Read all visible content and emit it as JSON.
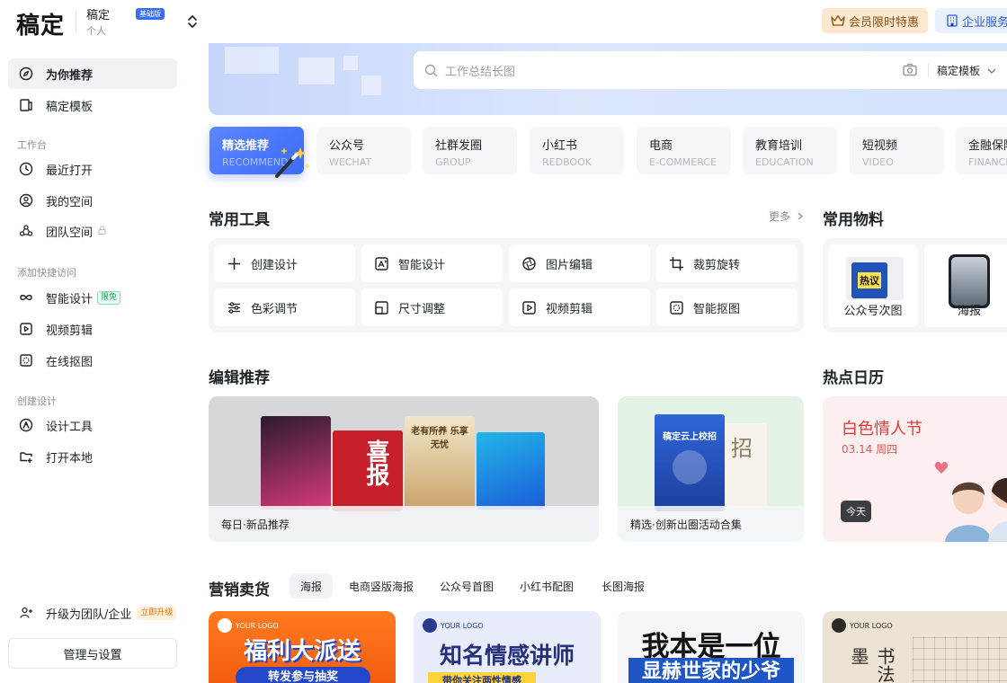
{
  "header": {
    "logo": "稿定",
    "workspace_name": "稿定",
    "workspace_type": "个人",
    "plan_badge": "基础版",
    "vip_label": "会员限时特惠",
    "enterprise_label": "企业服务"
  },
  "sidebar": {
    "top_items": [
      {
        "label": "为你推荐",
        "icon": "compass-icon"
      },
      {
        "label": "稿定模板",
        "icon": "template-icon"
      }
    ],
    "section_workspace": "工作台",
    "workspace_items": [
      {
        "label": "最近打开",
        "icon": "clock-icon"
      },
      {
        "label": "我的空间",
        "icon": "user-circle-icon"
      },
      {
        "label": "团队空间",
        "icon": "team-icon"
      }
    ],
    "section_quick": "添加快捷访问",
    "quick_items": [
      {
        "label": "智能设计",
        "tag": "限免",
        "icon": "infinity-icon"
      },
      {
        "label": "视频剪辑",
        "icon": "play-square-icon"
      },
      {
        "label": "在线抠图",
        "icon": "cutout-icon"
      }
    ],
    "section_create": "创建设计",
    "create_items": [
      {
        "label": "设计工具",
        "icon": "pen-nib-icon"
      },
      {
        "label": "打开本地",
        "icon": "folder-plus-icon"
      }
    ],
    "upgrade_label": "升级为团队/企业",
    "upgrade_tag": "立即升级",
    "settings_label": "管理与设置"
  },
  "search": {
    "placeholder": "工作总结长图",
    "scope": "稿定模板"
  },
  "categories": [
    {
      "cn": "精选推荐",
      "en": "RECOMMEND"
    },
    {
      "cn": "公众号",
      "en": "WECHAT"
    },
    {
      "cn": "社群发圈",
      "en": "GROUP"
    },
    {
      "cn": "小红书",
      "en": "REDBOOK"
    },
    {
      "cn": "电商",
      "en": "E-COMMERCE"
    },
    {
      "cn": "教育培训",
      "en": "EDUCATION"
    },
    {
      "cn": "短视频",
      "en": "VIDEO"
    },
    {
      "cn": "金融保险",
      "en": "FINANCIAL"
    }
  ],
  "tools": {
    "title": "常用工具",
    "more": "更多",
    "items": [
      {
        "label": "创建设计",
        "icon": "plus-icon"
      },
      {
        "label": "智能设计",
        "icon": "ai-design-icon"
      },
      {
        "label": "图片编辑",
        "icon": "aperture-icon"
      },
      {
        "label": "裁剪旋转",
        "icon": "crop-icon"
      },
      {
        "label": "色彩调节",
        "icon": "sliders-icon"
      },
      {
        "label": "尺寸调整",
        "icon": "resize-icon"
      },
      {
        "label": "视频剪辑",
        "icon": "play-square-icon"
      },
      {
        "label": "智能抠图",
        "icon": "cutout-icon"
      }
    ]
  },
  "materials": {
    "title": "常用物料",
    "items": [
      {
        "label": "公众号次图",
        "thumb_text": "热议"
      },
      {
        "label": "海报"
      }
    ]
  },
  "edit_recommend": {
    "title": "编辑推荐",
    "cards": [
      {
        "caption": "每日·新品推荐",
        "poster_texts": [
          "喜报",
          "老有所养 乐享无忧"
        ]
      },
      {
        "caption": "精选·创新出圈活动合集",
        "poster_texts": [
          "稿定云上校招",
          "招"
        ]
      }
    ]
  },
  "hot_calendar": {
    "title": "热点日历",
    "event": "白色情人节",
    "date": "03.14 周四",
    "today": "今天"
  },
  "marketing": {
    "title": "营销卖货",
    "tabs": [
      "海报",
      "电商竖版海报",
      "公众号首图",
      "小红书配图",
      "长图海报"
    ],
    "templates": [
      {
        "logo": "YOUR LOGO",
        "headline": "福利大派送",
        "sub": "转发参与抽奖"
      },
      {
        "logo": "YOUR LOGO",
        "headline": "知名情感讲师",
        "sub": "带你关注两性情感"
      },
      {
        "headline": "我本是一位",
        "sub": "显赫世家的少爷"
      },
      {
        "logo": "YOUR LOGO",
        "headline": "书法墨"
      }
    ]
  },
  "colors": {
    "accent": "#3e6bf5",
    "vip_bg": "#fbe8cf",
    "enterprise_bg": "#eaf0ff",
    "calendar_red": "#e23b3b"
  }
}
